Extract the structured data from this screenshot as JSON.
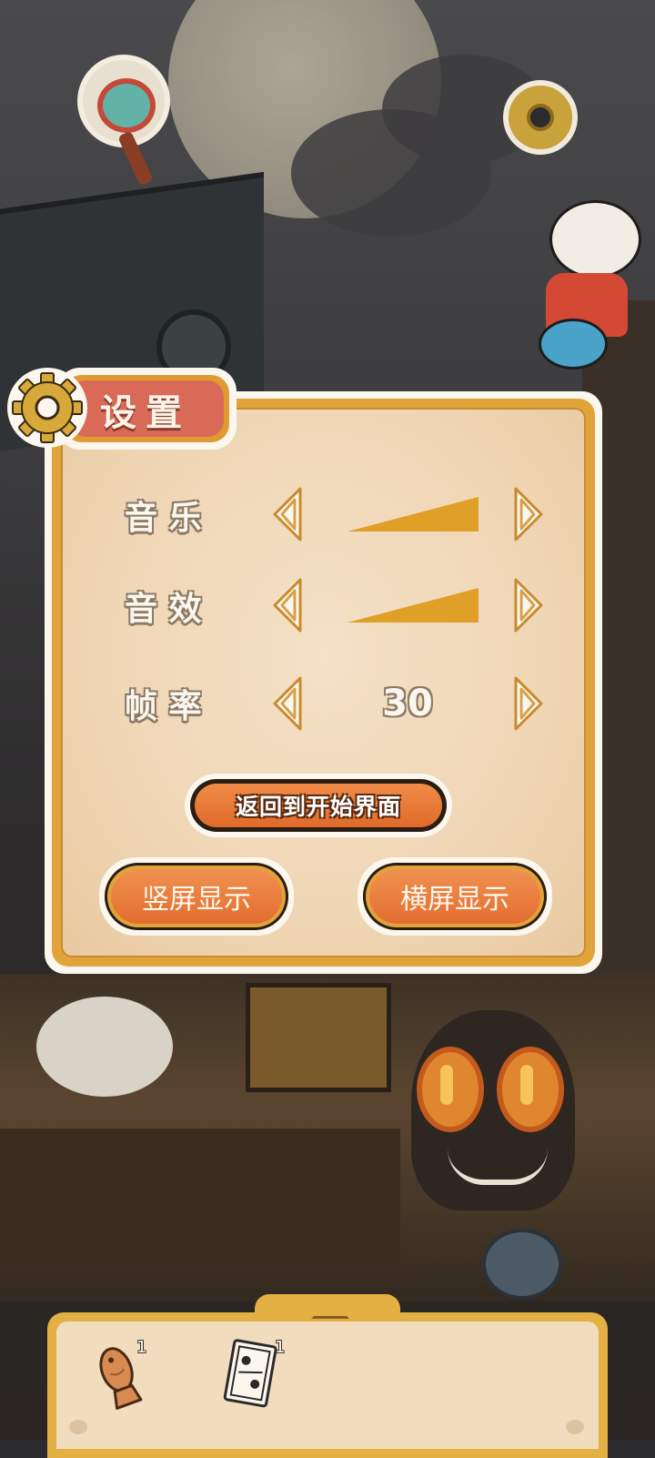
{
  "settings": {
    "title": "设置",
    "music_label": "音 乐",
    "sfx_label": "音 效",
    "fps_label": "帧 率",
    "music_level": 1.0,
    "sfx_level": 1.0,
    "fps_value": "30",
    "return_button": "返回到开始界面",
    "portrait_button": "竖屏显示",
    "landscape_button": "横屏显示"
  },
  "inventory": {
    "items": [
      {
        "icon": "taiyaki-fish-icon",
        "count": "1"
      },
      {
        "icon": "card-icon",
        "count": "1"
      }
    ]
  },
  "colors": {
    "accent_gold": "#e1a43a",
    "button_orange": "#e46d30",
    "panel_parchment": "#f4e1c6",
    "title_red": "#d96a58"
  }
}
